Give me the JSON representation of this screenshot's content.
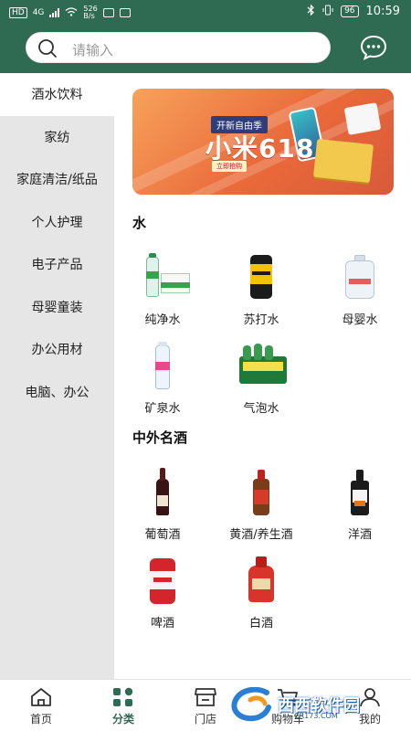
{
  "status_bar": {
    "left_hd": "HD",
    "left_signal_1": "4G",
    "left_speed": "526",
    "left_speed_unit": "B/s",
    "battery": "96",
    "time": "10:59"
  },
  "search": {
    "placeholder": "请输入"
  },
  "sidebar": {
    "items": [
      {
        "label": "酒水饮料",
        "active": true
      },
      {
        "label": "家纺",
        "active": false
      },
      {
        "label": "家庭清洁/纸品",
        "active": false
      },
      {
        "label": "个人护理",
        "active": false
      },
      {
        "label": "电子产品",
        "active": false
      },
      {
        "label": "母婴童装",
        "active": false
      },
      {
        "label": "办公用材",
        "active": false
      },
      {
        "label": "电脑、办公",
        "active": false
      }
    ]
  },
  "banner": {
    "tag": "开新自由季",
    "title": "小米618",
    "button": "立即抢购"
  },
  "sections": [
    {
      "title": "水",
      "items": [
        {
          "label": "纯净水",
          "icon": "pure-water-icon"
        },
        {
          "label": "苏打水",
          "icon": "soda-water-icon"
        },
        {
          "label": "母婴水",
          "icon": "baby-water-icon"
        },
        {
          "label": "矿泉水",
          "icon": "mineral-water-icon"
        },
        {
          "label": "气泡水",
          "icon": "sparkling-water-icon"
        }
      ]
    },
    {
      "title": "中外名酒",
      "items": [
        {
          "label": "葡萄酒",
          "icon": "wine-icon"
        },
        {
          "label": "黄酒/养生酒",
          "icon": "yellow-wine-icon"
        },
        {
          "label": "洋酒",
          "icon": "whiskey-icon"
        },
        {
          "label": "啤酒",
          "icon": "beer-icon"
        },
        {
          "label": "白酒",
          "icon": "baijiu-icon"
        }
      ]
    }
  ],
  "bottom_nav": {
    "items": [
      {
        "label": "首页",
        "icon": "home-icon",
        "active": false
      },
      {
        "label": "分类",
        "icon": "category-icon",
        "active": true
      },
      {
        "label": "门店",
        "icon": "store-icon",
        "active": false
      },
      {
        "label": "购物车",
        "icon": "cart-icon",
        "active": false
      },
      {
        "label": "我的",
        "icon": "profile-icon",
        "active": false
      }
    ]
  },
  "watermark": {
    "text": "西西软件园",
    "sub": "CR173.COM"
  },
  "colors": {
    "brand_green": "#2f6b52",
    "sidebar_bg": "#e6e6e6"
  }
}
